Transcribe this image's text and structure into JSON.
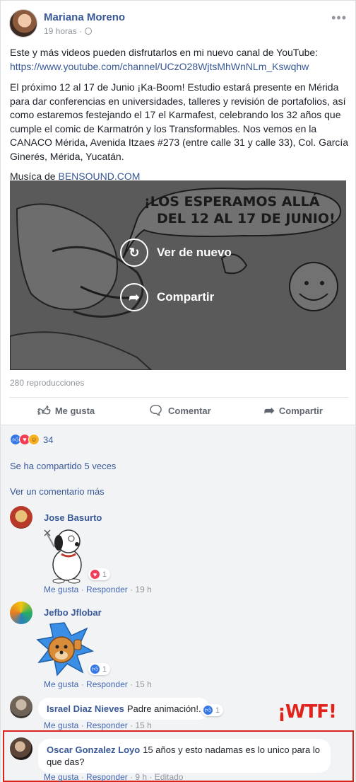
{
  "post": {
    "author": "Mariana Moreno",
    "time": "19 horas",
    "text_line1": "Este y más videos pueden disfrutarlos en mi nuevo canal de YouTube:",
    "link": "https://www.youtube.com/channel/UCzO28WjtsMhWnNLm_Kswqhw",
    "paragraph2": "El próximo 12 al 17 de Junio ¡Ka-Boom! Estudio estará presente en Mérida para dar conferencias en universidades, talleres y revisión de portafolios, así como estaremos festejando el 17 el Karmafest, celebrando los 32 años que cumple el comic de Karmatrón y los Transformables. Nos vemos en la CANACO Mérida, Avenida Itzaes #273 (entre calle 31 y calle 33), Col. García Ginerés, Mérida, Yucatán.",
    "music_prefix": "Musíca de",
    "music_link": "BENSOUND.COM"
  },
  "video": {
    "drawn_text_line1": "¡LOS ESPERAMOS ALLÁ",
    "drawn_text_line2": "DEL 12 AL 17 DE JUNIO!",
    "replay_label": "Ver de nuevo",
    "share_label": "Compartir",
    "views": "280 reproducciones"
  },
  "actions": {
    "like": "Me gusta",
    "comment": "Comentar",
    "share": "Compartir"
  },
  "reactions": {
    "count": "34",
    "shared": "Se ha compartido 5 veces",
    "more_comments": "Ver un comentario más"
  },
  "comments": [
    {
      "name": "Jose Basurto",
      "text": "",
      "reaction_count": "1",
      "like": "Me gusta",
      "reply": "Responder",
      "time": "19 h",
      "edited": ""
    },
    {
      "name": "Jefbo Jflobar",
      "text": "",
      "reaction_count": "1",
      "like": "Me gusta",
      "reply": "Responder",
      "time": "15 h",
      "edited": ""
    },
    {
      "name": "Israel Diaz Nieves",
      "text": "Padre animación!.",
      "reaction_count": "1",
      "like": "Me gusta",
      "reply": "Responder",
      "time": "15 h",
      "edited": ""
    },
    {
      "name": "Oscar Gonzalez Loyo",
      "text": "15 años y esto nadamas es lo unico para lo que das?",
      "reaction_count": "",
      "like": "Me gusta",
      "reply": "Responder",
      "time": "9 h",
      "edited": "Editado"
    }
  ],
  "annotation": "¡WTF!",
  "colors": {
    "link": "#385898",
    "like": "#3578e5",
    "love": "#f33e58",
    "highlight": "#d8241b"
  }
}
